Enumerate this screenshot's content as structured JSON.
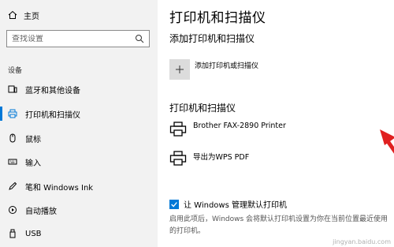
{
  "sidebar": {
    "home_label": "主页",
    "search_placeholder": "查找设置",
    "section_label": "设备",
    "items": [
      {
        "label": "蓝牙和其他设备",
        "icon": "bluetooth-device-icon"
      },
      {
        "label": "打印机和扫描仪",
        "icon": "printer-icon",
        "active": true
      },
      {
        "label": "鼠标",
        "icon": "mouse-icon"
      },
      {
        "label": "输入",
        "icon": "keyboard-icon"
      },
      {
        "label": "笔和 Windows Ink",
        "icon": "pen-icon"
      },
      {
        "label": "自动播放",
        "icon": "autoplay-icon"
      },
      {
        "label": "USB",
        "icon": "usb-icon"
      }
    ]
  },
  "main": {
    "title": "打印机和扫描仪",
    "add_section_title": "添加打印机和扫描仪",
    "add_button_label": "添加打印机或扫描仪",
    "printers_heading": "打印机和扫描仪",
    "printers": [
      {
        "name": "Brother FAX-2890 Printer"
      },
      {
        "name": "导出为WPS PDF"
      }
    ],
    "default_printer_checkbox_label": "让 Windows 管理默认打印机",
    "default_printer_checkbox_checked": true,
    "description": "启用此项后，Windows 会将默认打印机设置为你在当前位置最近使用的打印机。"
  },
  "colors": {
    "accent": "#0078d7",
    "sidebar_bg": "#f2f2f2",
    "arrow": "#e02020"
  },
  "watermark": "jingyan.baidu.com"
}
